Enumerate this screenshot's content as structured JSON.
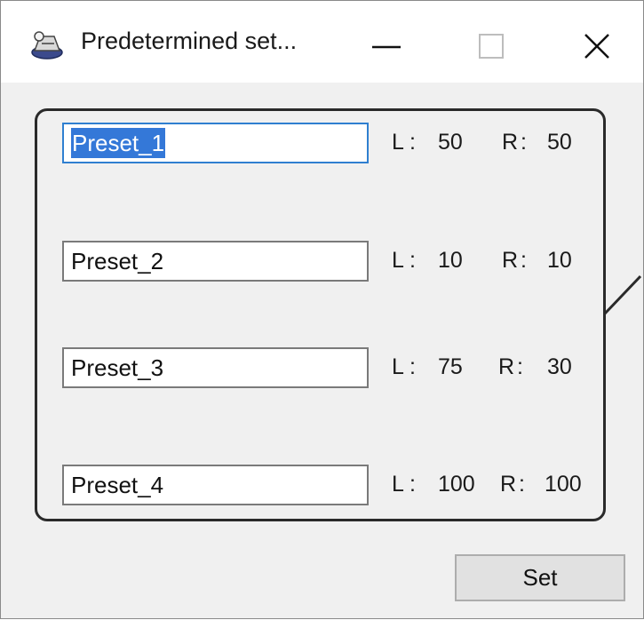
{
  "window": {
    "title": "Predetermined set..."
  },
  "presets": [
    {
      "name": "Preset_1",
      "l_label": "L",
      "l_value": "50",
      "r_label": "R",
      "r_value": "50"
    },
    {
      "name": "Preset_2",
      "l_label": "L",
      "l_value": "10",
      "r_label": "R",
      "r_value": "10"
    },
    {
      "name": "Preset_3",
      "l_label": "L",
      "l_value": "75",
      "r_label": "R",
      "r_value": "30"
    },
    {
      "name": "Preset_4",
      "l_label": "L",
      "l_value": "100",
      "r_label": "R",
      "r_value": "100"
    }
  ],
  "footer": {
    "set_label": "Set"
  },
  "colors": {
    "selection": "#3478d8",
    "focus_border": "#2f7fd0",
    "window_bg": "#f0f0f0"
  },
  "icons": {
    "app": "speaker-app-icon",
    "minimize": "minimize-icon",
    "maximize": "maximize-icon",
    "close": "close-icon"
  }
}
